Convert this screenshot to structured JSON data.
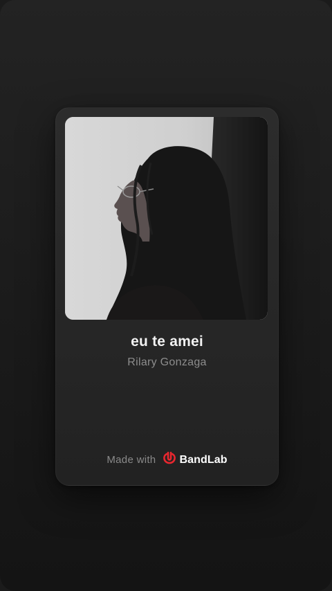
{
  "track": {
    "title": "eu te amei",
    "artist": "Rilary Gonzaga",
    "cover_art": "portrait-photo"
  },
  "footer": {
    "made_with_label": "Made with",
    "brand_name": "BandLab",
    "brand_icon": "bandlab-logo-icon"
  },
  "colors": {
    "background": "#1c1c1c",
    "card": "#292929",
    "title": "#f2f2f2",
    "artist": "#8d8d8d",
    "brand_red": "#e8272f"
  }
}
